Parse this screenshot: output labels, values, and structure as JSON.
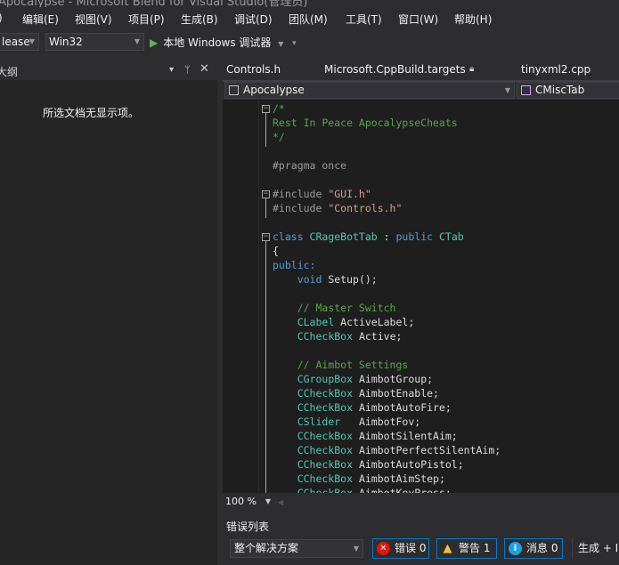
{
  "window": {
    "title": "Apocalypse - Microsoft Blend for Visual Studio(管理员)"
  },
  "menu": [
    {
      "label": ")",
      "name": "menu-file-partial"
    },
    {
      "label": "编辑(E)",
      "name": "menu-edit"
    },
    {
      "label": "视图(V)",
      "name": "menu-view"
    },
    {
      "label": "项目(P)",
      "name": "menu-project"
    },
    {
      "label": "生成(B)",
      "name": "menu-build"
    },
    {
      "label": "调试(D)",
      "name": "menu-debug"
    },
    {
      "label": "团队(M)",
      "name": "menu-team"
    },
    {
      "label": "工具(T)",
      "name": "menu-tools"
    },
    {
      "label": "窗口(W)",
      "name": "menu-window"
    },
    {
      "label": "帮助(H)",
      "name": "menu-help"
    }
  ],
  "toolbar": {
    "configuration": "lease",
    "platform": "Win32",
    "run_label": "本地 Windows 调试器",
    "overflow": "▾"
  },
  "outline": {
    "title": "大纲",
    "empty_message": "所选文档无显示项。",
    "dropdown_icon": "▾",
    "pin_icon": "ᛘ",
    "close_icon": "✕"
  },
  "tabs": [
    {
      "label": "Controls.h"
    },
    {
      "label": "Microsoft.CppBuild.targets"
    },
    {
      "label": "tinyxml2.cpp"
    }
  ],
  "navbar": {
    "project": "Apocalypse",
    "scope": "CMiscTab"
  },
  "code_lines": [
    [
      {
        "t": "/*",
        "c": "comment"
      }
    ],
    [
      {
        "t": "Rest In Peace ApocalypseCheats",
        "c": "comment"
      }
    ],
    [
      {
        "t": "*/",
        "c": "comment"
      }
    ],
    [],
    [
      {
        "t": "#pragma once",
        "c": "pre"
      }
    ],
    [],
    [
      {
        "t": "#include ",
        "c": "pre"
      },
      {
        "t": "\"GUI.h\"",
        "c": "string"
      }
    ],
    [
      {
        "t": "#include ",
        "c": "pre"
      },
      {
        "t": "\"Controls.h\"",
        "c": "string"
      }
    ],
    [],
    [
      {
        "t": "class ",
        "c": "keyword"
      },
      {
        "t": "CRageBotTab",
        "c": "type"
      },
      {
        "t": " : ",
        "c": "plain"
      },
      {
        "t": "public ",
        "c": "keyword"
      },
      {
        "t": "CTab",
        "c": "type"
      }
    ],
    [
      {
        "t": "{",
        "c": "plain"
      }
    ],
    [
      {
        "t": "public:",
        "c": "keyword"
      }
    ],
    [
      {
        "t": "    ",
        "c": "plain"
      },
      {
        "t": "void ",
        "c": "keyword"
      },
      {
        "t": "Setup();",
        "c": "plain"
      }
    ],
    [],
    [
      {
        "t": "    // Master Switch",
        "c": "comment"
      }
    ],
    [
      {
        "t": "    ",
        "c": "plain"
      },
      {
        "t": "CLabel ",
        "c": "type"
      },
      {
        "t": "ActiveLabel;",
        "c": "plain"
      }
    ],
    [
      {
        "t": "    ",
        "c": "plain"
      },
      {
        "t": "CCheckBox ",
        "c": "type"
      },
      {
        "t": "Active;",
        "c": "plain"
      }
    ],
    [],
    [
      {
        "t": "    // Aimbot Settings",
        "c": "comment"
      }
    ],
    [
      {
        "t": "    ",
        "c": "plain"
      },
      {
        "t": "CGroupBox ",
        "c": "type"
      },
      {
        "t": "AimbotGroup;",
        "c": "plain"
      }
    ],
    [
      {
        "t": "    ",
        "c": "plain"
      },
      {
        "t": "CCheckBox ",
        "c": "type"
      },
      {
        "t": "AimbotEnable;",
        "c": "plain"
      }
    ],
    [
      {
        "t": "    ",
        "c": "plain"
      },
      {
        "t": "CCheckBox ",
        "c": "type"
      },
      {
        "t": "AimbotAutoFire;",
        "c": "plain"
      }
    ],
    [
      {
        "t": "    ",
        "c": "plain"
      },
      {
        "t": "CSlider   ",
        "c": "type"
      },
      {
        "t": "AimbotFov;",
        "c": "plain"
      }
    ],
    [
      {
        "t": "    ",
        "c": "plain"
      },
      {
        "t": "CCheckBox ",
        "c": "type"
      },
      {
        "t": "AimbotSilentAim;",
        "c": "plain"
      }
    ],
    [
      {
        "t": "    ",
        "c": "plain"
      },
      {
        "t": "CCheckBox ",
        "c": "type"
      },
      {
        "t": "AimbotPerfectSilentAim;",
        "c": "plain"
      }
    ],
    [
      {
        "t": "    ",
        "c": "plain"
      },
      {
        "t": "CCheckBox ",
        "c": "type"
      },
      {
        "t": "AimbotAutoPistol;",
        "c": "plain"
      }
    ],
    [
      {
        "t": "    ",
        "c": "plain"
      },
      {
        "t": "CCheckBox ",
        "c": "type"
      },
      {
        "t": "AimbotAimStep;",
        "c": "plain"
      }
    ],
    [
      {
        "t": "    ",
        "c": "plain"
      },
      {
        "t": "CCheckBox ",
        "c": "type"
      },
      {
        "t": "AimbotKeyPress;",
        "c": "plain"
      }
    ]
  ],
  "fold_markers": [
    0,
    6,
    9
  ],
  "editor_status": {
    "zoom": "100 %"
  },
  "error_list": {
    "title": "错误列表",
    "scope": "整个解决方案",
    "errors_label": "错误 0",
    "warnings_label": "警告 1",
    "messages_label": "消息 0",
    "build_label": "生成 + I"
  },
  "colors": {
    "background": "#2d2d30",
    "editor_bg": "#1e1e1e",
    "comment": "#57a64a",
    "keyword": "#569cd6",
    "type": "#4ec9b0",
    "string": "#d69d85",
    "accent": "#007acc"
  }
}
